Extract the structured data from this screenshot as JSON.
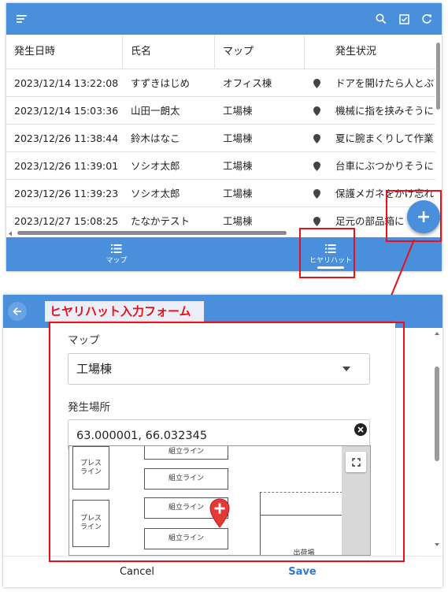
{
  "list_screen": {
    "columns": [
      "発生日時",
      "氏名",
      "マップ",
      "発生状況"
    ],
    "rows": [
      {
        "datetime": "2023/12/14 13:22:08",
        "name": "すずきはじめ",
        "map": "オフィス棟",
        "situation": "ドアを開けたら人とぶ"
      },
      {
        "datetime": "2023/12/14 15:03:36",
        "name": "山田一朗太",
        "map": "工場棟",
        "situation": "機械に指を挟みそうに"
      },
      {
        "datetime": "2023/12/26 11:38:44",
        "name": "鈴木はなこ",
        "map": "工場棟",
        "situation": "夏に腕まくりして作業"
      },
      {
        "datetime": "2023/12/26 11:39:01",
        "name": "ソシオ太郎",
        "map": "工場棟",
        "situation": "台車にぶつかりそうに"
      },
      {
        "datetime": "2023/12/26 11:39:23",
        "name": "ソシオ太郎",
        "map": "工場棟",
        "situation": "保護メガネをかけ忘れ"
      },
      {
        "datetime": "2023/12/27 15:08:25",
        "name": "たなかテスト",
        "map": "工場棟",
        "situation": "足元の部品箱に"
      }
    ],
    "nav": {
      "map_label": "マップ",
      "hiyarihatto_label": "ヒヤリハット",
      "active": "hiyarihatto"
    },
    "icons": [
      "menu-icon",
      "search-icon",
      "checkbox-icon",
      "refresh-icon",
      "map-pin-icon",
      "add-icon",
      "list-icon"
    ]
  },
  "form_screen": {
    "title": "ヒヤリハット入力フォーム",
    "map_field": {
      "label": "マップ",
      "value": "工場棟"
    },
    "location_field": {
      "label": "発生場所",
      "value": "63.000001, 66.032345"
    },
    "floor_map": {
      "rooms": [
        "プレス\nライン",
        "プレス\nライン",
        "組立ライン",
        "組立ライン",
        "組立ライン",
        "組立ライン",
        "出荷場"
      ]
    },
    "buttons": {
      "cancel": "Cancel",
      "save": "Save"
    }
  },
  "colors": {
    "accent": "#4a8fdc",
    "annotation": "#e8101a",
    "marker": "#e53935"
  }
}
